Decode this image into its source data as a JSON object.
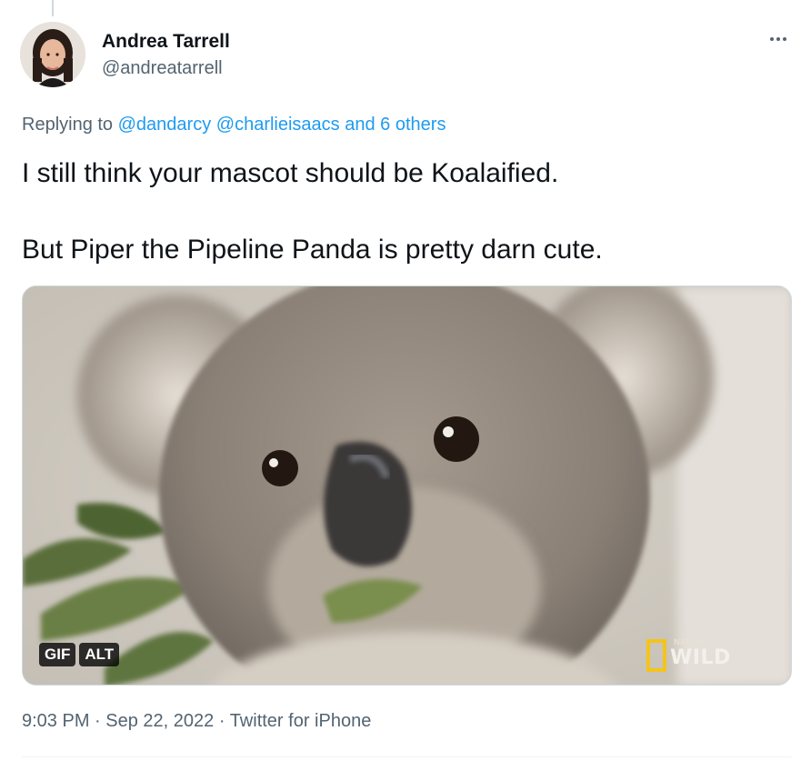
{
  "author": {
    "name": "Andrea Tarrell",
    "handle": "@andreatarrell"
  },
  "replying": {
    "prefix": "Replying to",
    "mention1": "@dandarcy",
    "mention2": "@charlieisaacs",
    "others": "and 6 others"
  },
  "tweet": {
    "line1": "I still think your mascot should be Koalaified.",
    "line2": "But Piper the Pipeline Panda is pretty darn cute."
  },
  "media": {
    "gif_badge": "GIF",
    "alt_badge": "ALT",
    "watermark_small": "NAT GEO",
    "watermark": "WILD"
  },
  "meta": {
    "time": "9:03 PM",
    "sep1": " · ",
    "date": "Sep 22, 2022",
    "sep2": " · ",
    "source": "Twitter for iPhone"
  },
  "icons": {
    "more": "more-icon"
  },
  "colors": {
    "link": "#1d9bf0",
    "secondary_text": "#536471",
    "primary_text": "#0f1419"
  }
}
